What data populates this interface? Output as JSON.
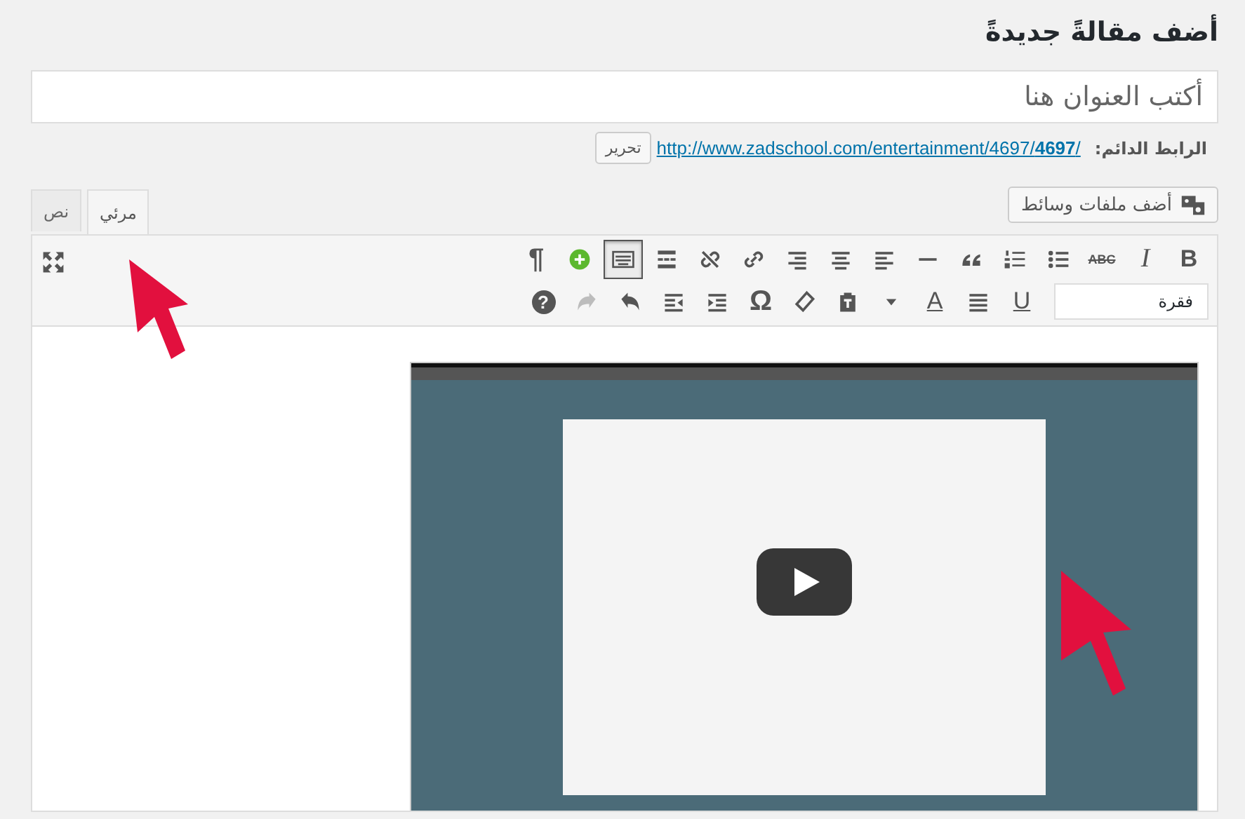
{
  "page_title": "أضف مقالةً جديدةً",
  "title_field": {
    "placeholder": "أكتب العنوان هنا"
  },
  "permalink": {
    "label": "الرابط الدائم:",
    "url": "http://www.zadschool.com/entertainment/4697/**4697**/",
    "edit_button": "تحرير"
  },
  "add_media_button": "أضف ملفات وسائط",
  "tabs": [
    {
      "label": "مرئي",
      "selected": true
    },
    {
      "label": "نص",
      "selected": false
    }
  ],
  "toolbar": {
    "rows": [
      [
        {
          "kind": "bold",
          "label": "B",
          "pressed": false,
          "disabled": false
        },
        {
          "kind": "italic",
          "label": "I",
          "pressed": false,
          "disabled": false
        },
        {
          "kind": "strike",
          "label": "ABC",
          "pressed": false,
          "disabled": false
        },
        {
          "kind": "bullets",
          "pressed": false,
          "disabled": false
        },
        {
          "kind": "numbers",
          "pressed": false,
          "disabled": false
        },
        {
          "kind": "quote",
          "pressed": false,
          "disabled": false
        },
        {
          "kind": "rule",
          "pressed": false,
          "disabled": false
        },
        {
          "kind": "alignleft",
          "pressed": false,
          "disabled": false
        },
        {
          "kind": "aligncenter",
          "pressed": false,
          "disabled": false
        },
        {
          "kind": "alignright",
          "pressed": false,
          "disabled": false
        },
        {
          "kind": "link",
          "pressed": false,
          "disabled": false
        },
        {
          "kind": "unlink",
          "pressed": false,
          "disabled": false
        },
        {
          "kind": "more",
          "pressed": false,
          "disabled": false
        },
        {
          "kind": "keyboard",
          "pressed": true,
          "disabled": false
        },
        {
          "kind": "add",
          "pressed": false,
          "disabled": false
        },
        {
          "kind": "pilcrow",
          "label": "¶",
          "pressed": false,
          "disabled": false
        }
      ],
      [
        {
          "kind": "underline",
          "label": "U",
          "pressed": false,
          "disabled": false
        },
        {
          "kind": "justify",
          "pressed": false,
          "disabled": false
        },
        {
          "kind": "textcolor",
          "label": "A",
          "pressed": false,
          "disabled": false
        },
        {
          "kind": "caret",
          "pressed": false,
          "disabled": false
        },
        {
          "kind": "paste",
          "pressed": false,
          "disabled": false
        },
        {
          "kind": "eraser",
          "pressed": false,
          "disabled": false
        },
        {
          "kind": "omega",
          "label": "Ω",
          "pressed": false,
          "disabled": false
        },
        {
          "kind": "indent",
          "pressed": false,
          "disabled": false
        },
        {
          "kind": "outdent",
          "pressed": false,
          "disabled": false
        },
        {
          "kind": "undo",
          "pressed": false,
          "disabled": false
        },
        {
          "kind": "redo",
          "pressed": false,
          "disabled": true
        },
        {
          "kind": "help",
          "label": "?",
          "pressed": false,
          "disabled": false
        }
      ]
    ]
  },
  "format_select": {
    "value": "فقرة"
  }
}
